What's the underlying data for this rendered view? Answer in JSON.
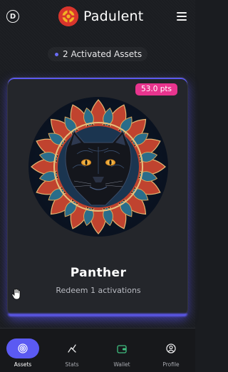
{
  "header": {
    "left_badge": "D",
    "brand_name": "Padulent"
  },
  "activated_label": "2 Activated Assets",
  "card": {
    "points_badge": "53.0 pts",
    "title": "Panther",
    "subtitle": "Redeem 1 activations"
  },
  "nav": {
    "items": [
      {
        "label": "Assets",
        "icon": "spiral-icon",
        "active": true
      },
      {
        "label": "Stats",
        "icon": "stats-icon",
        "active": false
      },
      {
        "label": "Wallet",
        "icon": "wallet-icon",
        "active": false
      },
      {
        "label": "Profile",
        "icon": "profile-icon",
        "active": false
      }
    ]
  },
  "colors": {
    "accent": "#5b5af2",
    "badge": "#e8348e",
    "brand_logo": "#d8352c",
    "background": "#1b1d21",
    "wallet_icon": "#3fbf7f"
  }
}
